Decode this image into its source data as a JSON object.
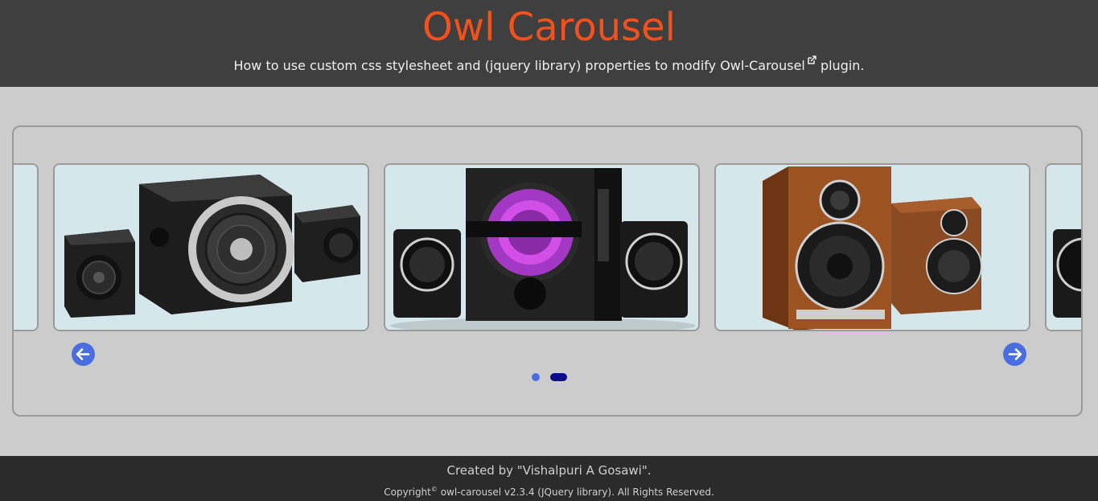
{
  "header": {
    "title": "Owl Carousel",
    "subtitle_text": "How to use custom css stylesheet and (jquery library) properties to modify",
    "plugin_link": "Owl-Carousel",
    "subtitle_suffix": "plugin."
  },
  "carousel": {
    "slides": [
      {
        "name": "partial-left-slide",
        "icon": "speaker-image"
      },
      {
        "name": "speaker-system-silver",
        "icon": "speaker-image"
      },
      {
        "name": "speaker-system-fd-purple",
        "icon": "speaker-image"
      },
      {
        "name": "speaker-wooden-bookshelf",
        "icon": "speaker-image"
      },
      {
        "name": "partial-right-slide",
        "icon": "speaker-image"
      }
    ],
    "prev_icon": "arrow-left-icon",
    "next_icon": "arrow-right-icon",
    "pages": 2,
    "active_page": 2,
    "colors": {
      "nav": "#4a6ee0",
      "dot_inactive": "#4a6ee0",
      "dot_active": "#0d0d8c",
      "title": "#f4511e"
    }
  },
  "footer": {
    "credit": "Created by \"Vishalpuri A Gosawi\".",
    "copyright_word": "Copyright",
    "copyright_mark": "©",
    "copyright_text": " owl-carousel v2.3.4 (JQuery library). All Rights Reserved."
  }
}
